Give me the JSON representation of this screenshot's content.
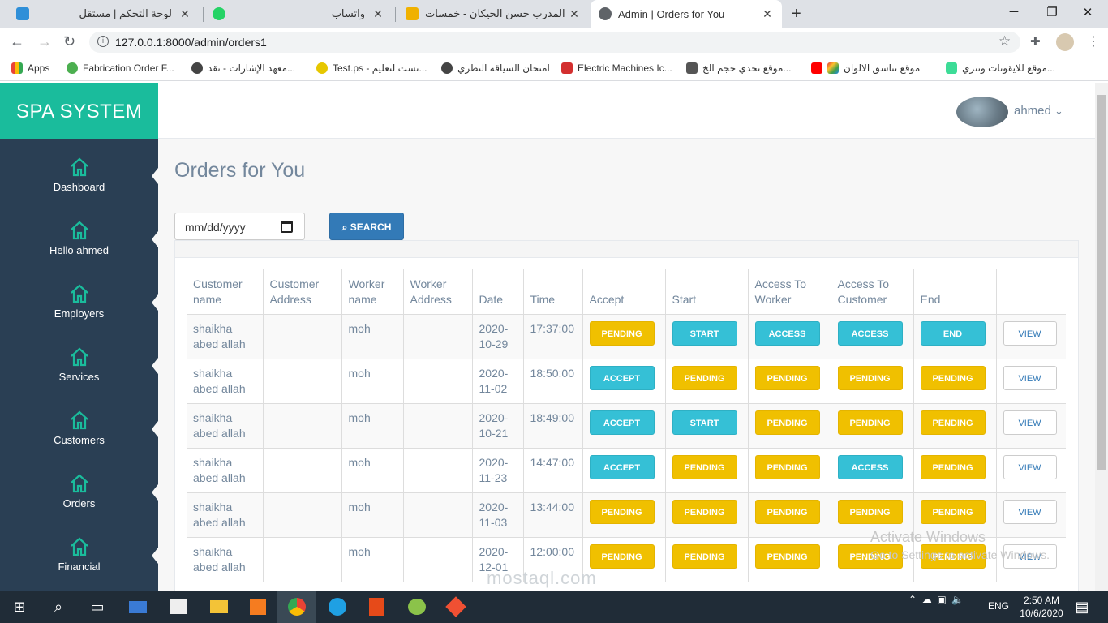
{
  "browser": {
    "tabs": [
      {
        "title": "لوحة التحكم | مستقل",
        "active": false
      },
      {
        "title": "واتساب",
        "active": false
      },
      {
        "title": "المدرب حسن الحيكان - خمسات",
        "active": false
      },
      {
        "title": "Admin | Orders for You",
        "active": true
      }
    ],
    "url": "127.0.0.1:8000/admin/orders1",
    "bookmarks": [
      "Apps",
      "Fabrication Order F...",
      "معهد الإشارات - تقد...",
      "Test.ps - تست لتعليم...",
      "امتحان السياقة النظري",
      "Electric Machines Ic...",
      "موقع تحدي حجم الخ...",
      "موقع تناسق الالوان",
      "موقع للايقونات وتنزي..."
    ]
  },
  "brand": "SPA SYSTEM",
  "sidebar": {
    "items": [
      {
        "label": "Dashboard"
      },
      {
        "label": "Hello ahmed"
      },
      {
        "label": "Employers"
      },
      {
        "label": "Services"
      },
      {
        "label": "Customers"
      },
      {
        "label": "Orders"
      },
      {
        "label": "Financial"
      }
    ]
  },
  "topnav": {
    "username": "ahmed",
    "caret": "⌄"
  },
  "page": {
    "title": "Orders for You",
    "date_placeholder": "mm/dd/yyyy",
    "search_label": "SEARCH"
  },
  "table": {
    "headers": [
      "Customer name",
      "Customer Address",
      "Worker name",
      "Worker Address",
      "Date",
      "Time",
      "Accept",
      "Start",
      "Access To Worker",
      "Access To Customer",
      "End",
      ""
    ],
    "rows": [
      {
        "customer": "shaikha abed allah",
        "caddr": "",
        "worker": "moh",
        "waddr": "",
        "date": "2020-10-29",
        "time": "17:37:00",
        "accept": "PENDING",
        "start": "START",
        "access_worker": "ACCESS",
        "access_customer": "ACCESS",
        "end": "END",
        "view": "VIEW"
      },
      {
        "customer": "shaikha abed allah",
        "caddr": "",
        "worker": "moh",
        "waddr": "",
        "date": "2020-11-02",
        "time": "18:50:00",
        "accept": "ACCEPT",
        "start": "PENDING",
        "access_worker": "PENDING",
        "access_customer": "PENDING",
        "end": "PENDING",
        "view": "VIEW"
      },
      {
        "customer": "shaikha abed allah",
        "caddr": "",
        "worker": "moh",
        "waddr": "",
        "date": "2020-10-21",
        "time": "18:49:00",
        "accept": "ACCEPT",
        "start": "START",
        "access_worker": "PENDING",
        "access_customer": "PENDING",
        "end": "PENDING",
        "view": "VIEW"
      },
      {
        "customer": "shaikha abed allah",
        "caddr": "",
        "worker": "moh",
        "waddr": "",
        "date": "2020-11-23",
        "time": "14:47:00",
        "accept": "ACCEPT",
        "start": "PENDING",
        "access_worker": "PENDING",
        "access_customer": "ACCESS",
        "end": "PENDING",
        "view": "VIEW"
      },
      {
        "customer": "shaikha abed allah",
        "caddr": "",
        "worker": "moh",
        "waddr": "",
        "date": "2020-11-03",
        "time": "13:44:00",
        "accept": "PENDING",
        "start": "PENDING",
        "access_worker": "PENDING",
        "access_customer": "PENDING",
        "end": "PENDING",
        "view": "VIEW"
      },
      {
        "customer": "shaikha abed allah",
        "caddr": "",
        "worker": "moh",
        "waddr": "",
        "date": "2020-12-01",
        "time": "12:00:00",
        "accept": "PENDING",
        "start": "PENDING",
        "access_worker": "PENDING",
        "access_customer": "PENDING",
        "end": "PENDING",
        "view": "VIEW"
      }
    ]
  },
  "overlay": {
    "activate_title": "Activate Windows",
    "activate_sub": "Go to Settings to activate Windows.",
    "watermark": "mostaql.com"
  },
  "taskbar": {
    "lang": "ENG",
    "time": "2:50 AM",
    "date": "10/6/2020"
  },
  "colors": {
    "brand": "#1abc9c",
    "sidebar": "#2a3f54",
    "warning": "#f0c000",
    "info": "#35c0d6",
    "primary": "#337ab7"
  }
}
